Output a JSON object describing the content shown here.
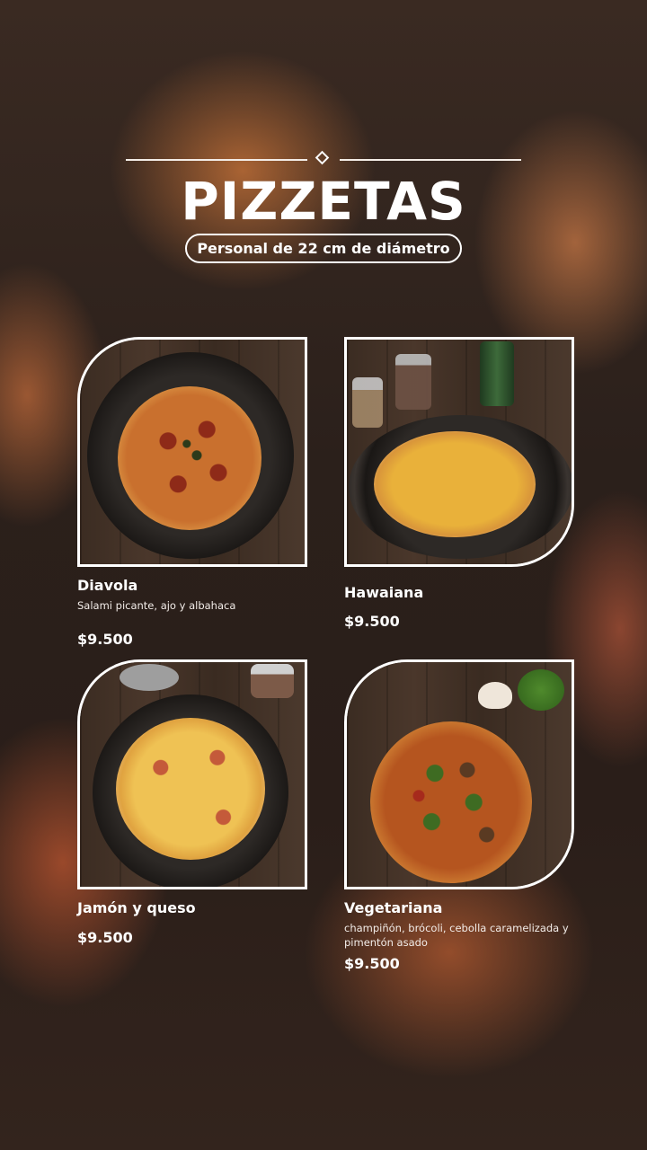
{
  "header": {
    "title": "PIZZETAS",
    "subtitle": "Personal de 22 cm de diámetro"
  },
  "items": [
    {
      "name": "Diavola",
      "description": "Salami picante, ajo y albahaca",
      "price": "$9.500"
    },
    {
      "name": "Hawaiana",
      "description": "",
      "price": "$9.500"
    },
    {
      "name": "Jamón y queso",
      "description": "",
      "price": "$9.500"
    },
    {
      "name": "Vegetariana",
      "description": "champiñón, brócoli, cebolla caramelizada y pimentón asado",
      "price": "$9.500"
    }
  ],
  "colors": {
    "text": "#ffffff",
    "background": "#2a1f1a",
    "accent": "#c8642e"
  }
}
